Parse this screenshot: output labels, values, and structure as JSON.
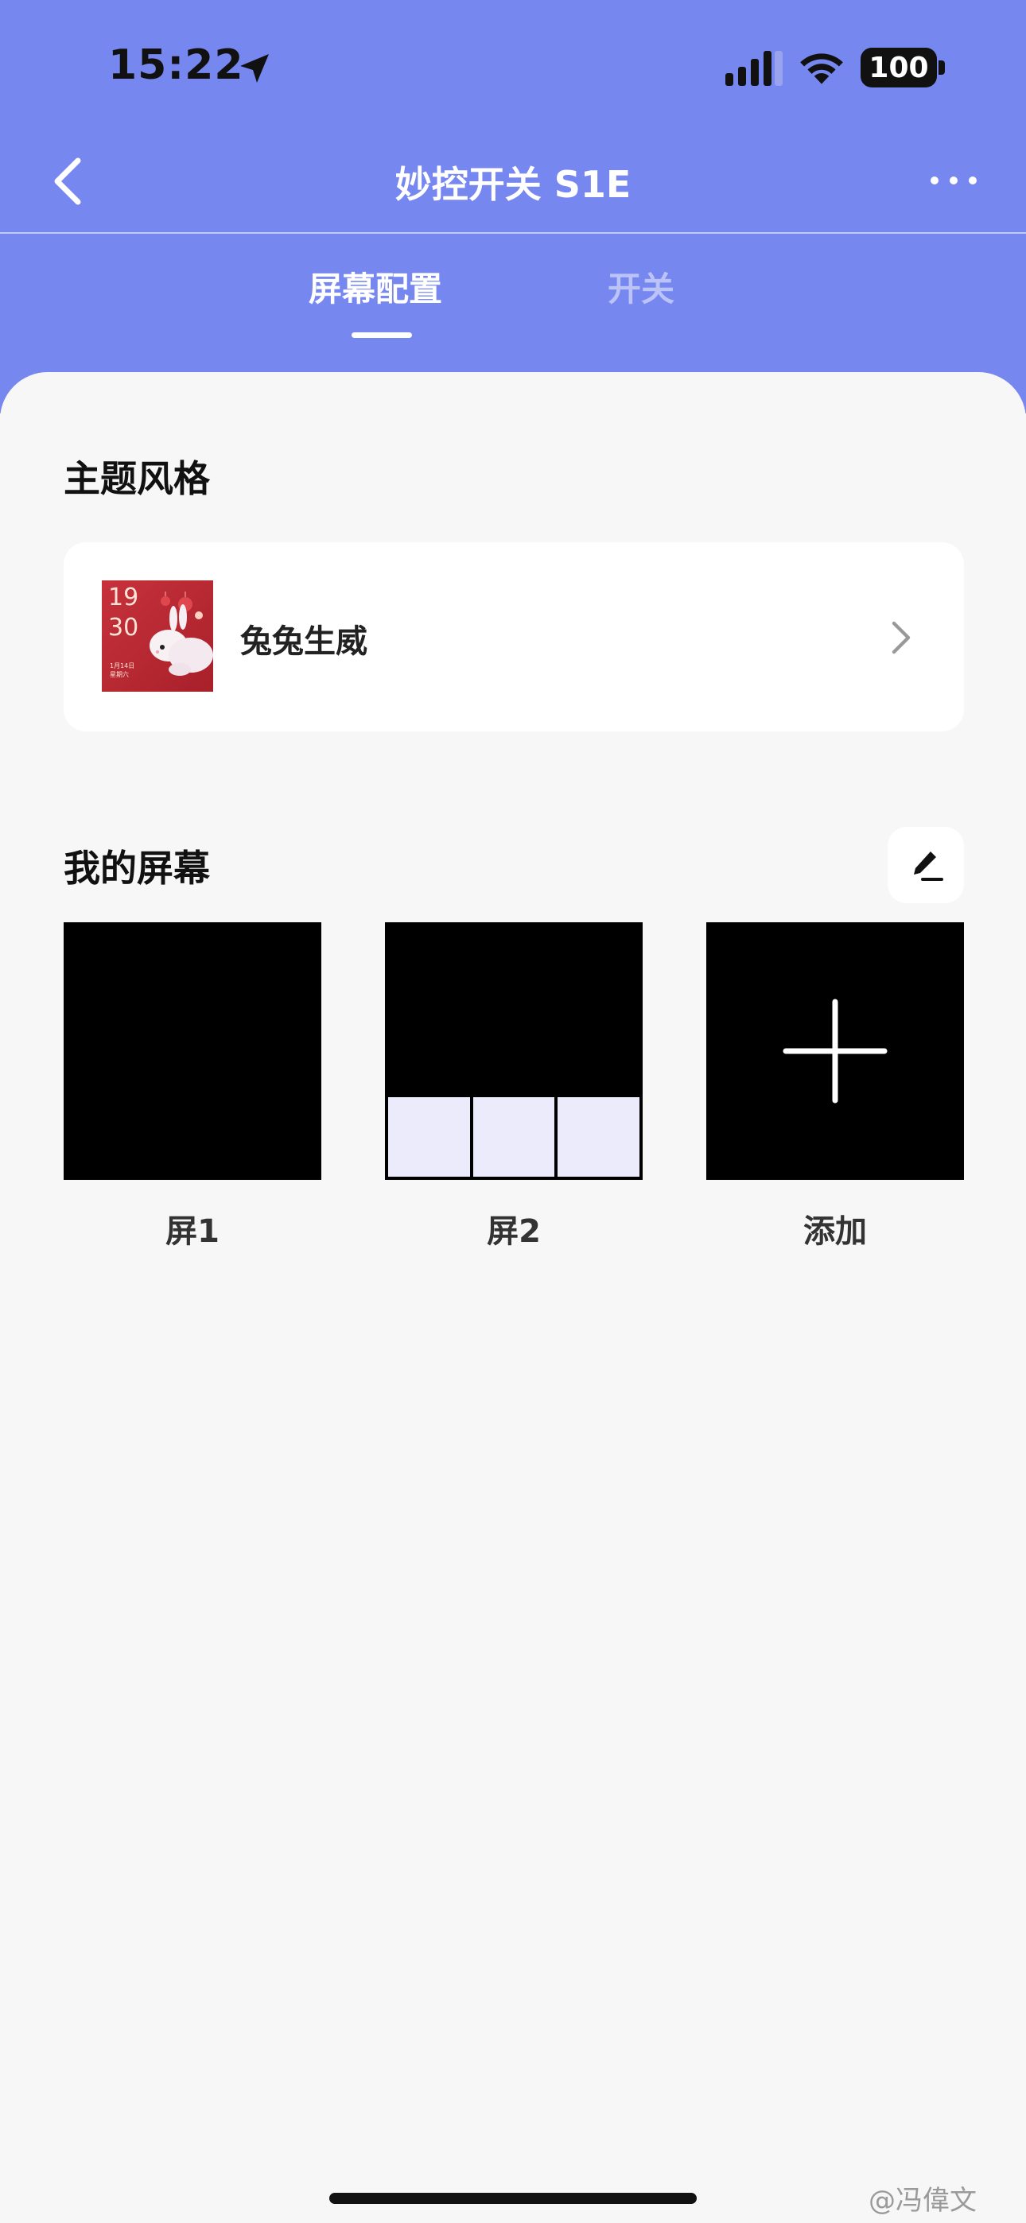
{
  "status_bar": {
    "time": "15:22",
    "battery": "100"
  },
  "nav": {
    "title": "妙控开关 S1E"
  },
  "tabs": [
    {
      "label": "屏幕配置",
      "active": true
    },
    {
      "label": "开关",
      "active": false
    }
  ],
  "theme_section": {
    "title": "主题风格",
    "theme_name": "兔兔生威",
    "thumbnail": {
      "hour": "19",
      "minute": "30",
      "date_line1": "1月14日",
      "date_line2": "星期六"
    }
  },
  "screens_section": {
    "title": "我的屏幕",
    "screens": [
      {
        "label": "屏1"
      },
      {
        "label": "屏2"
      },
      {
        "label": "添加"
      }
    ]
  },
  "watermark": "@冯偉文",
  "colors": {
    "header": "#7787f0",
    "background": "#f7f7f7",
    "card": "#ffffff",
    "cell": "#ebebfb"
  }
}
